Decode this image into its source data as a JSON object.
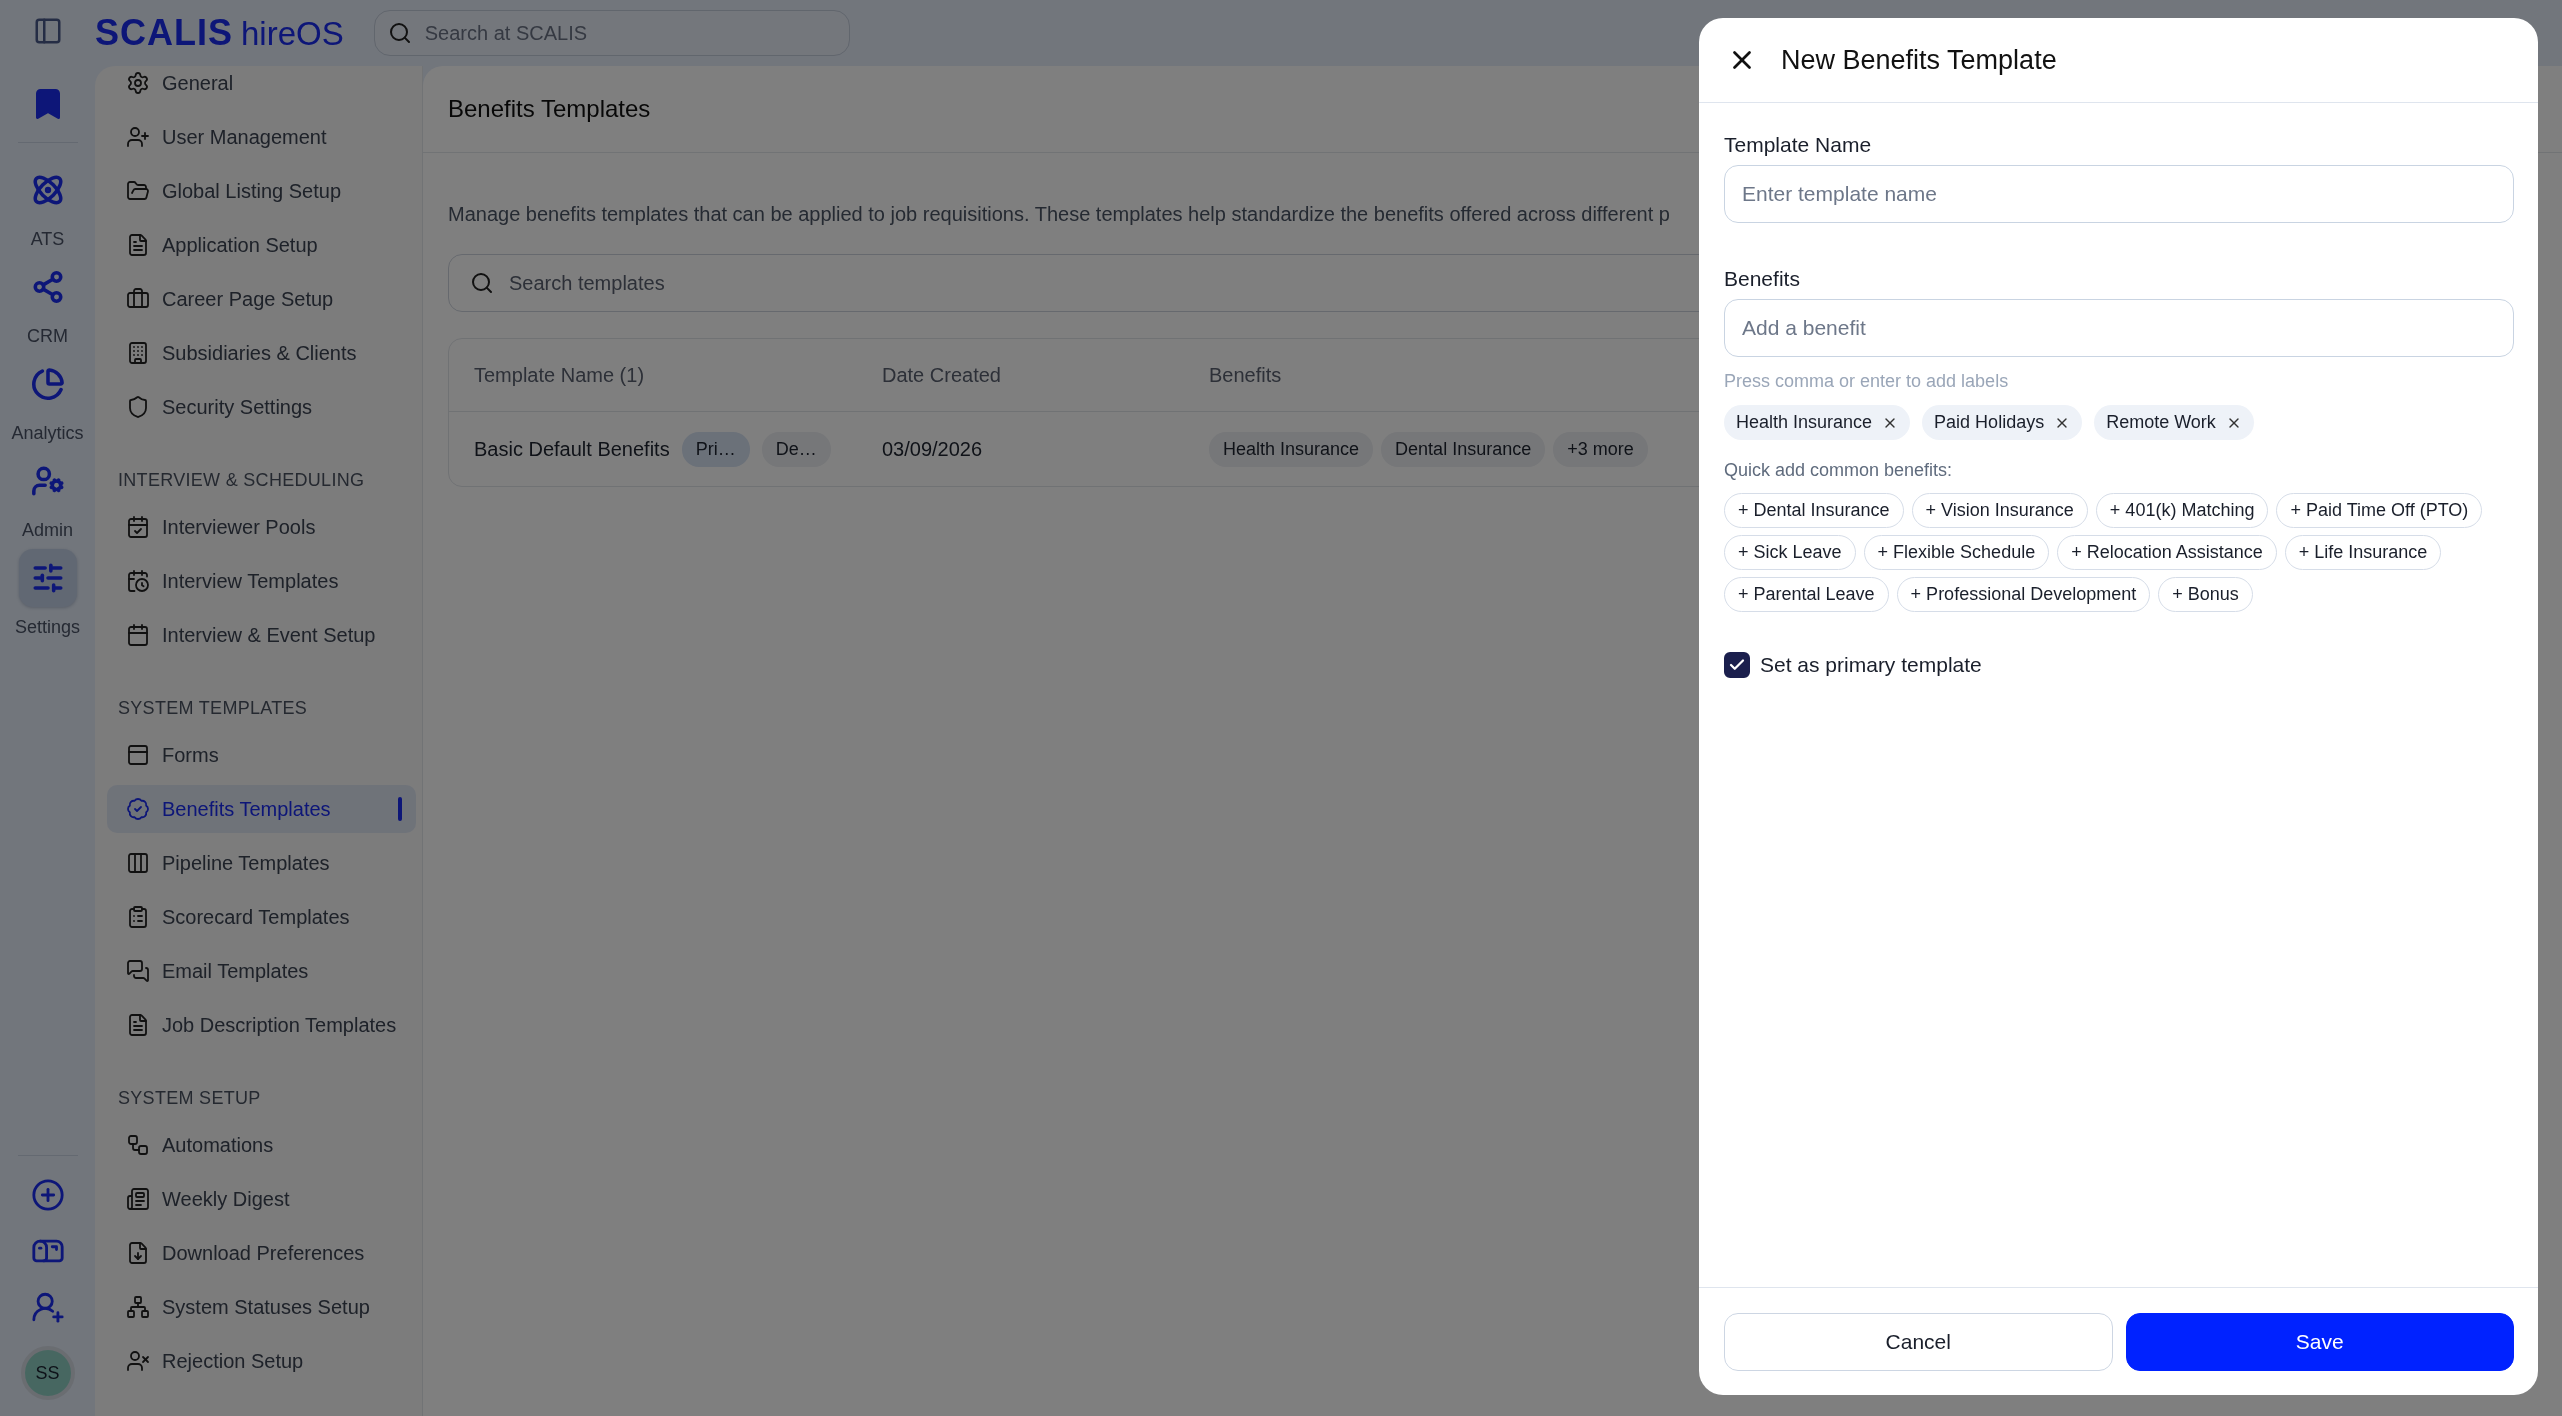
{
  "brand": {
    "name": "SCALIS",
    "product": "hireOS"
  },
  "global_search": {
    "placeholder": "Search at SCALIS"
  },
  "rail": {
    "items": [
      {
        "label": "ATS",
        "selected": false
      },
      {
        "label": "CRM",
        "selected": false
      },
      {
        "label": "Analytics",
        "selected": false
      },
      {
        "label": "Admin",
        "selected": false
      },
      {
        "label": "Settings",
        "selected": true
      }
    ],
    "avatar": "SS"
  },
  "sidebar": {
    "sections": [
      {
        "items": [
          {
            "label": "General",
            "selected": false
          },
          {
            "label": "User Management",
            "selected": false
          },
          {
            "label": "Global Listing Setup",
            "selected": false
          },
          {
            "label": "Application Setup",
            "selected": false
          },
          {
            "label": "Career Page Setup",
            "selected": false
          },
          {
            "label": "Subsidiaries & Clients",
            "selected": false
          },
          {
            "label": "Security Settings",
            "selected": false
          }
        ]
      },
      {
        "heading": "INTERVIEW & SCHEDULING",
        "items": [
          {
            "label": "Interviewer Pools",
            "selected": false
          },
          {
            "label": "Interview Templates",
            "selected": false
          },
          {
            "label": "Interview & Event Setup",
            "selected": false
          }
        ]
      },
      {
        "heading": "SYSTEM TEMPLATES",
        "items": [
          {
            "label": "Forms",
            "selected": false
          },
          {
            "label": "Benefits Templates",
            "selected": true
          },
          {
            "label": "Pipeline Templates",
            "selected": false
          },
          {
            "label": "Scorecard Templates",
            "selected": false
          },
          {
            "label": "Email Templates",
            "selected": false
          },
          {
            "label": "Job Description Templates",
            "selected": false
          }
        ]
      },
      {
        "heading": "SYSTEM SETUP",
        "items": [
          {
            "label": "Automations",
            "selected": false
          },
          {
            "label": "Weekly Digest",
            "selected": false
          },
          {
            "label": "Download Preferences",
            "selected": false
          },
          {
            "label": "System Statuses Setup",
            "selected": false
          },
          {
            "label": "Rejection Setup",
            "selected": false
          }
        ]
      }
    ]
  },
  "page": {
    "title": "Benefits Templates",
    "description": "Manage benefits templates that can be applied to job requisitions. These templates help standardize the benefits offered across different p",
    "search": {
      "placeholder": "Search templates"
    },
    "table": {
      "columns": [
        "Template Name (1)",
        "Date Created",
        "Benefits"
      ],
      "rows": [
        {
          "name": "Basic Default Benefits",
          "tags": [
            {
              "label": "Pri…",
              "kind": "primary"
            },
            {
              "label": "De…",
              "kind": "default"
            }
          ],
          "date": "03/09/2026",
          "benefits": [
            "Health Insurance",
            "Dental Insurance",
            "+3 more"
          ]
        }
      ]
    }
  },
  "dialog": {
    "title": "New Benefits Template",
    "fields": [
      {
        "label": "Template Name",
        "placeholder": "Enter template name"
      },
      {
        "label": "Benefits",
        "placeholder": "Add a benefit"
      }
    ],
    "hint": "Press comma or enter to add labels",
    "selected_benefits": [
      "Health Insurance",
      "Paid Holidays",
      "Remote Work"
    ],
    "quick_add_label": "Quick add common benefits:",
    "quick_add": [
      "+ Dental Insurance",
      "+ Vision Insurance",
      "+ 401(k) Matching",
      "+ Paid Time Off (PTO)",
      "+ Sick Leave",
      "+ Flexible Schedule",
      "+ Relocation Assistance",
      "+ Life Insurance",
      "+ Parental Leave",
      "+ Professional Development",
      "+ Bonus"
    ],
    "primary": {
      "label": "Set as primary template",
      "checked": true
    },
    "buttons": [
      {
        "label": "Cancel",
        "kind": "secondary"
      },
      {
        "label": "Save",
        "kind": "primary"
      }
    ]
  }
}
